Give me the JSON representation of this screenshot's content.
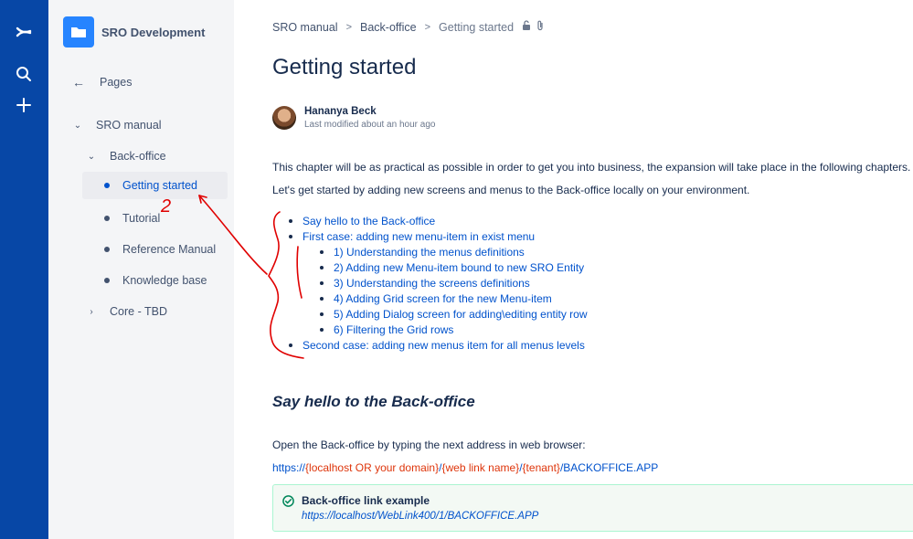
{
  "globalnav": {
    "logo_icon": "confluence-logo-icon",
    "search_icon": "search-icon",
    "create_icon": "plus-icon",
    "color": "#0747a6"
  },
  "sidebar": {
    "space_name": "SRO Development",
    "pages_label": "Pages",
    "tree": [
      {
        "label": "SRO manual",
        "expanded": true
      },
      {
        "label": "Back-office",
        "expanded": true
      },
      {
        "label": "Getting started",
        "active": true
      },
      {
        "label": "Tutorial"
      },
      {
        "label": "Reference Manual"
      },
      {
        "label": "Knowledge base"
      },
      {
        "label": "Core - TBD",
        "expanded": false
      }
    ]
  },
  "breadcrumb": {
    "items": [
      "SRO manual",
      "Back-office",
      "Getting started"
    ]
  },
  "page": {
    "title": "Getting started",
    "author": "Hananya Beck",
    "modified": "Last modified about an hour ago",
    "intro1": "This chapter will be as practical as possible in order to get you into business, the expansion will take place in the following chapters.",
    "intro2": "Let's get started by adding new screens and menus to the Back-office locally on your environment.",
    "toc": [
      "Say hello to the Back-office",
      "First case: adding new menu-item in exist menu",
      "1)  Understanding the menus definitions",
      "2)  Adding new Menu-item bound to new SRO Entity",
      "3)  Understanding the screens definitions",
      "4) Adding Grid screen for the new Menu-item",
      "5) Adding Dialog screen for adding\\editing entity row",
      "6) Filtering the Grid rows",
      "Second case: adding new menus item for all menus levels"
    ],
    "section_heading": "Say hello to the Back-office",
    "section_text": "Open the Back-office by typing the next address in web browser:",
    "url": {
      "p1": "https://",
      "p2": "{localhost OR your domain}",
      "p3": "/",
      "p4": "{web link name}",
      "p5": "/",
      "p6": "{tenant}",
      "p7": "/BACKOFFICE.APP"
    },
    "panel": {
      "title": "Back-office link example",
      "body": "https://localhost/WebLink400/1/BACKOFFICE.APP"
    }
  },
  "annotation": {
    "label": "2",
    "color": "#e00000"
  }
}
